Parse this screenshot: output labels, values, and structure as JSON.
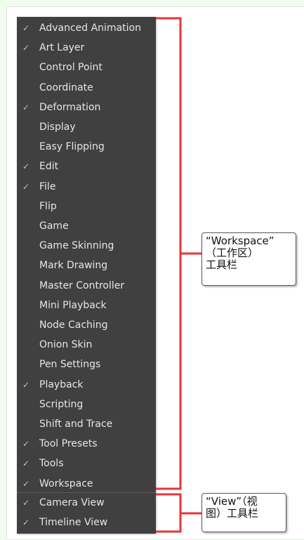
{
  "menu": {
    "items": [
      {
        "label": "Advanced Animation",
        "checked": true
      },
      {
        "label": "Art Layer",
        "checked": true
      },
      {
        "label": "Control Point",
        "checked": false
      },
      {
        "label": "Coordinate",
        "checked": false
      },
      {
        "label": "Deformation",
        "checked": true
      },
      {
        "label": "Display",
        "checked": false
      },
      {
        "label": "Easy Flipping",
        "checked": false
      },
      {
        "label": "Edit",
        "checked": true
      },
      {
        "label": "File",
        "checked": true
      },
      {
        "label": "Flip",
        "checked": false
      },
      {
        "label": "Game",
        "checked": false
      },
      {
        "label": "Game Skinning",
        "checked": false
      },
      {
        "label": "Mark Drawing",
        "checked": false
      },
      {
        "label": "Master Controller",
        "checked": false
      },
      {
        "label": "Mini Playback",
        "checked": false
      },
      {
        "label": "Node Caching",
        "checked": false
      },
      {
        "label": "Onion Skin",
        "checked": false
      },
      {
        "label": "Pen Settings",
        "checked": false
      },
      {
        "label": "Playback",
        "checked": true
      },
      {
        "label": "Scripting",
        "checked": false
      },
      {
        "label": "Shift and Trace",
        "checked": false
      },
      {
        "label": "Tool Presets",
        "checked": true
      },
      {
        "label": "Tools",
        "checked": true
      },
      {
        "label": "Workspace",
        "checked": true
      },
      {
        "label": "Camera View",
        "checked": true
      },
      {
        "label": "Timeline View",
        "checked": true
      }
    ]
  },
  "callouts": {
    "workspace": {
      "line1": "“Workspace”",
      "line2": "（工作区）",
      "line3": "工具栏"
    },
    "view": {
      "line1": "“View”（视",
      "line2": "图）工具栏"
    }
  },
  "colors": {
    "bracket": "#e8343a",
    "menu_bg": "#404040",
    "menu_text": "#e6e6e6"
  },
  "icons": {
    "check": "checkmark-icon"
  }
}
